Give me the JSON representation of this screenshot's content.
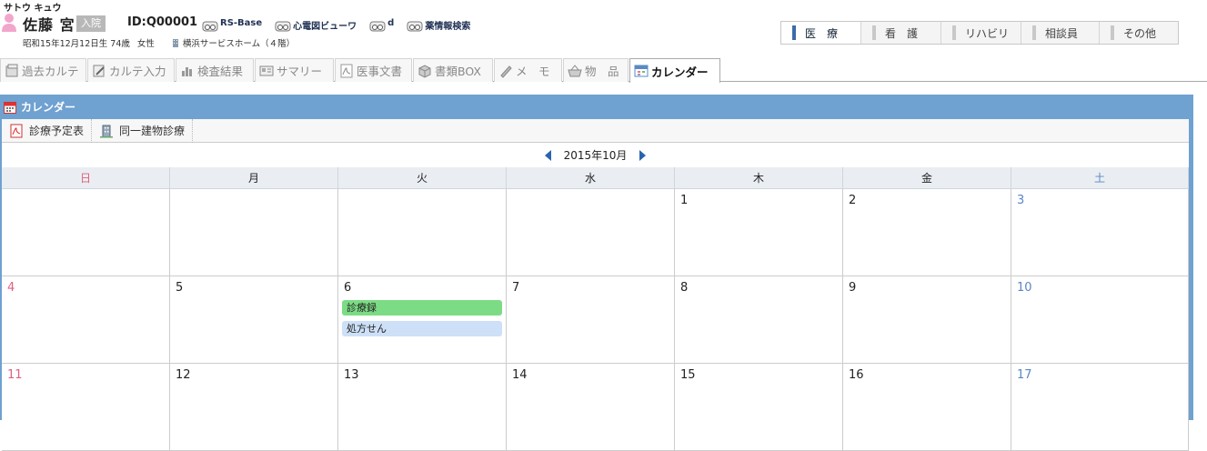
{
  "patient": {
    "kana": "サトウ キュウ",
    "name": "佐藤 宮",
    "status_badge": "入院",
    "id": "ID:Q00001",
    "birth": "昭和15年12月12日生 74歳",
    "gender": "女性",
    "facility": "横浜サービスホーム（４階）"
  },
  "header_links": [
    {
      "label": "RS-Base",
      "icon": "viewer-icon"
    },
    {
      "label": "心電図ビューワ",
      "icon": "viewer-icon"
    },
    {
      "label": "d",
      "icon": "viewer-icon"
    },
    {
      "label": "薬情報検索",
      "icon": "viewer-icon"
    }
  ],
  "top_nav": [
    {
      "label": "医　療",
      "active": true
    },
    {
      "label": "看　護",
      "active": false
    },
    {
      "label": "リハビリ",
      "active": false
    },
    {
      "label": "相談員",
      "active": false
    },
    {
      "label": "その他",
      "active": false
    }
  ],
  "tabs": [
    {
      "label": "過去カルテ",
      "icon": "history-icon"
    },
    {
      "label": "カルテ入力",
      "icon": "edit-icon"
    },
    {
      "label": "検査結果",
      "icon": "bar-chart-icon"
    },
    {
      "label": "サマリー",
      "icon": "summary-icon"
    },
    {
      "label": "医事文書",
      "icon": "pdf-icon"
    },
    {
      "label": "書類BOX",
      "icon": "box-icon"
    },
    {
      "label": "メ　モ",
      "icon": "pencil-icon"
    },
    {
      "label": "物　品",
      "icon": "basket-icon"
    },
    {
      "label": "カレンダー",
      "icon": "calendar-icon",
      "active": true
    }
  ],
  "panel": {
    "title": "カレンダー",
    "toolbar": [
      {
        "label": "診療予定表",
        "icon": "pdf-icon"
      },
      {
        "label": "同一建物診療",
        "icon": "building-icon"
      }
    ],
    "month": "2015年10月"
  },
  "calendar": {
    "weekdays": [
      "日",
      "月",
      "火",
      "水",
      "木",
      "金",
      "土"
    ],
    "weeks": [
      [
        "",
        "",
        "",
        "",
        "1",
        "2",
        "3"
      ],
      [
        "4",
        "5",
        "6",
        "7",
        "8",
        "9",
        "10"
      ],
      [
        "11",
        "12",
        "13",
        "14",
        "15",
        "16",
        "17"
      ]
    ],
    "events": [
      {
        "week": 1,
        "day": 2,
        "items": [
          {
            "label": "診療録",
            "color": "#7cdc85"
          },
          {
            "label": "処方せん",
            "color": "#cde0f7"
          }
        ]
      }
    ]
  },
  "colors": {
    "accent": "#6fa1d1",
    "sunday": "#e0607e",
    "saturday": "#5b86c5"
  }
}
